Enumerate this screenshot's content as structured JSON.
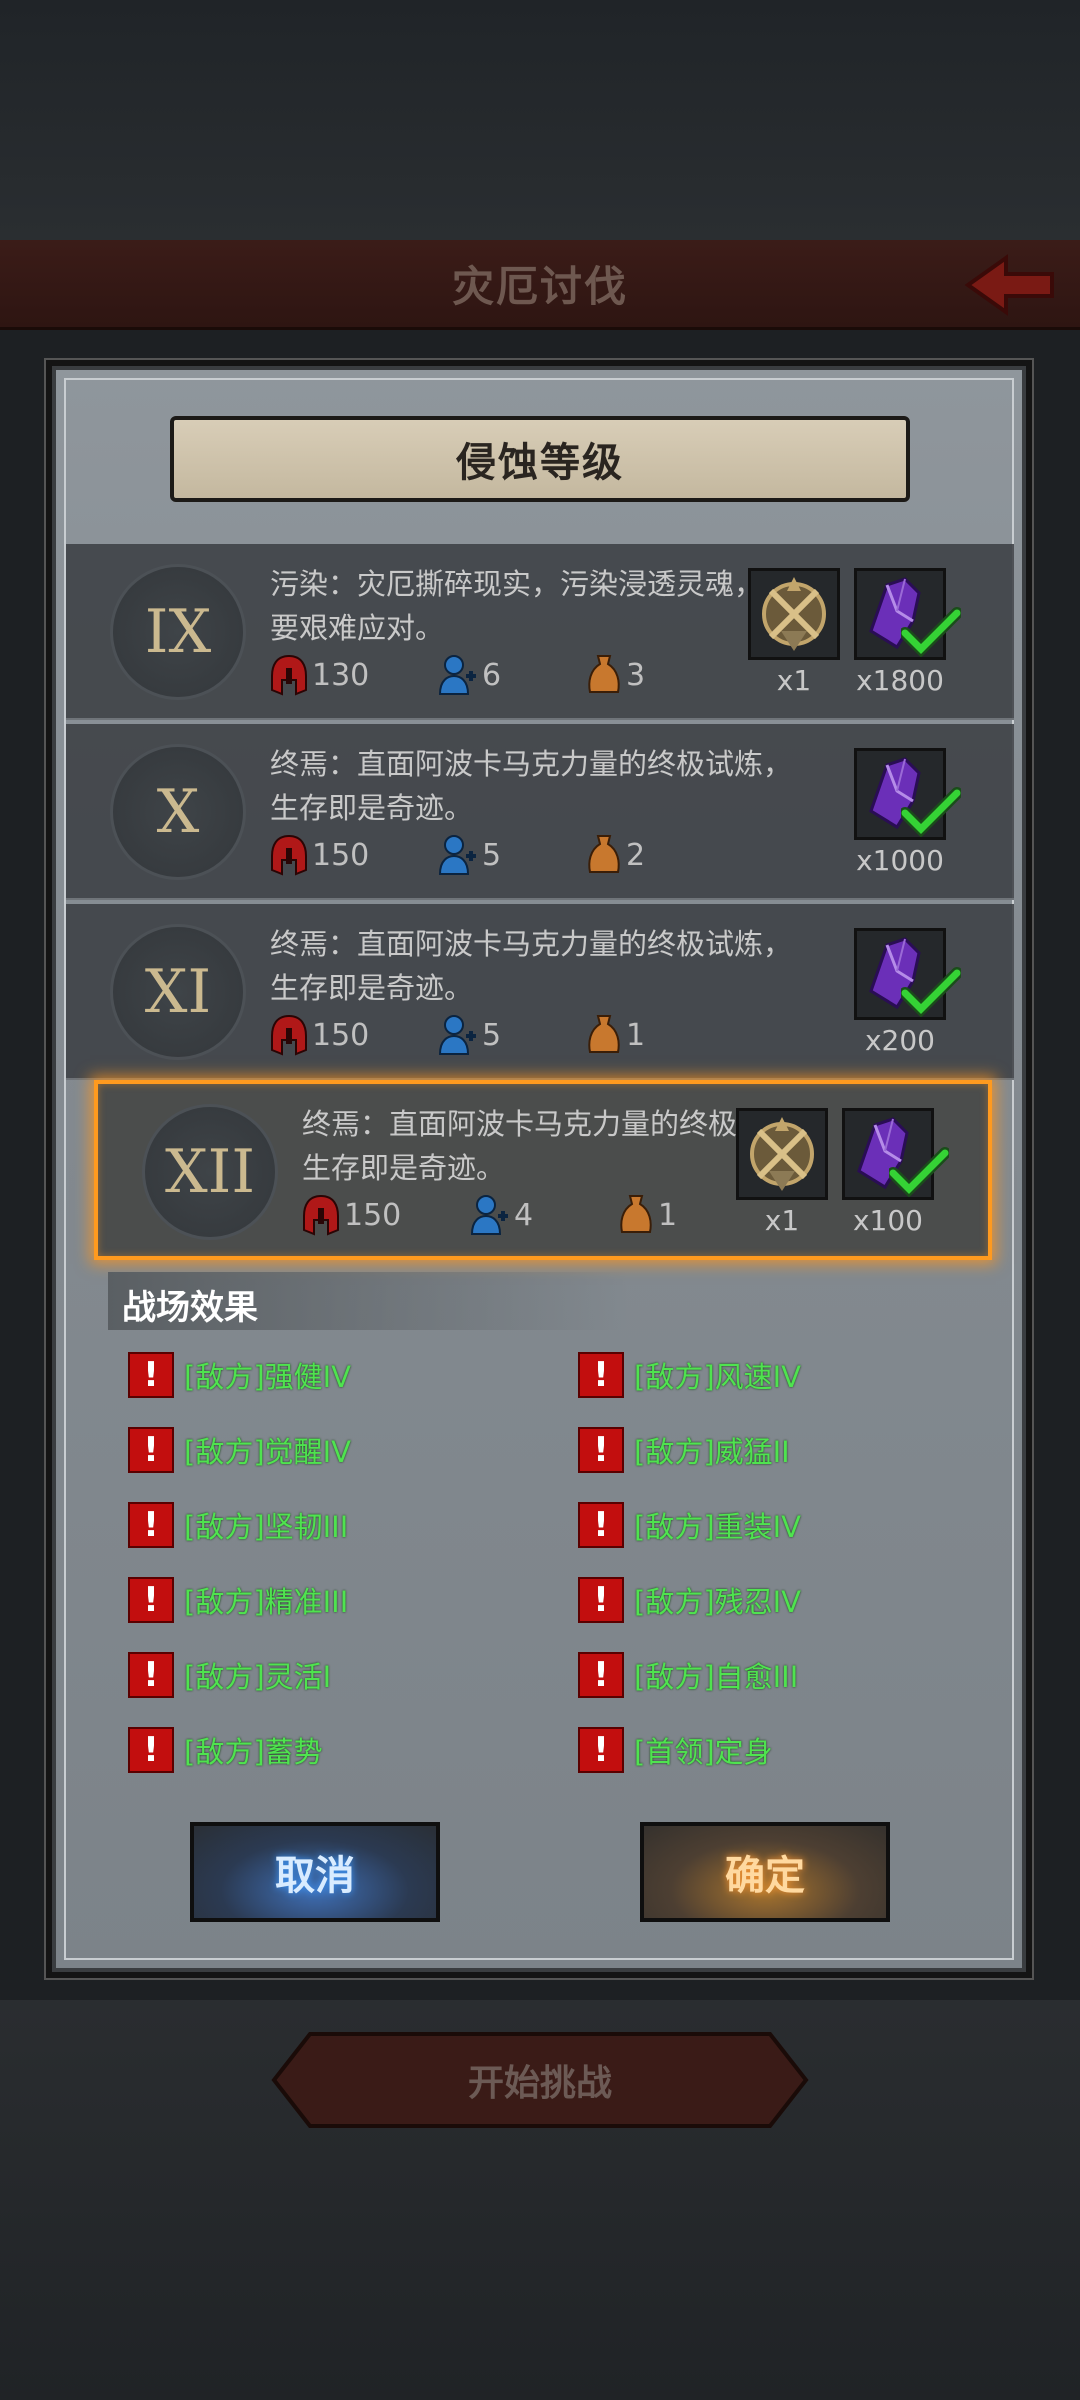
{
  "header": {
    "title": "灾厄讨伐"
  },
  "footer": {
    "start_label": "开始挑战"
  },
  "dialog": {
    "title": "侵蚀等级",
    "levels": [
      {
        "roman": "IX",
        "description": "污染：灾厄撕碎现实，污染浸透灵魂，需要艰难应对。",
        "stat_helmet": "130",
        "stat_player": "6",
        "stat_bag": "3",
        "rewards": [
          {
            "icon": "emblem-icon",
            "qty": "x1"
          },
          {
            "icon": "purple-crystal-icon",
            "qty": "x1800",
            "checked": true
          }
        ]
      },
      {
        "roman": "X",
        "description": "终焉：直面阿波卡马克力量的终极试炼，生存即是奇迹。",
        "stat_helmet": "150",
        "stat_player": "5",
        "stat_bag": "2",
        "rewards": [
          {
            "icon": "purple-crystal-icon",
            "qty": "x1000",
            "checked": true
          }
        ]
      },
      {
        "roman": "XI",
        "description": "终焉：直面阿波卡马克力量的终极试炼，生存即是奇迹。",
        "stat_helmet": "150",
        "stat_player": "5",
        "stat_bag": "1",
        "rewards": [
          {
            "icon": "purple-crystal-icon",
            "qty": "x200",
            "checked": true
          }
        ]
      },
      {
        "roman": "XII",
        "description": "终焉：直面阿波卡马克力量的终极试炼，生存即是奇迹。",
        "stat_helmet": "150",
        "stat_player": "4",
        "stat_bag": "1",
        "selected": true,
        "rewards": [
          {
            "icon": "emblem-icon",
            "qty": "x1"
          },
          {
            "icon": "purple-crystal-icon",
            "qty": "x100",
            "checked": true
          }
        ]
      }
    ],
    "effects_title": "战场效果",
    "effects": [
      "[敌方]强健IV",
      "[敌方]风速IV",
      "[敌方]觉醒IV",
      "[敌方]威猛II",
      "[敌方]坚韧III",
      "[敌方]重装IV",
      "[敌方]精准III",
      "[敌方]残忍IV",
      "[敌方]灵活I",
      "[敌方]自愈III",
      "[敌方]蓄势",
      "[首领]定身"
    ],
    "cancel_label": "取消",
    "confirm_label": "确定"
  },
  "colors": {
    "effect_text": "#4fe34f",
    "selected_border": "#ff9a1f",
    "warning_red": "#c20e0e"
  }
}
